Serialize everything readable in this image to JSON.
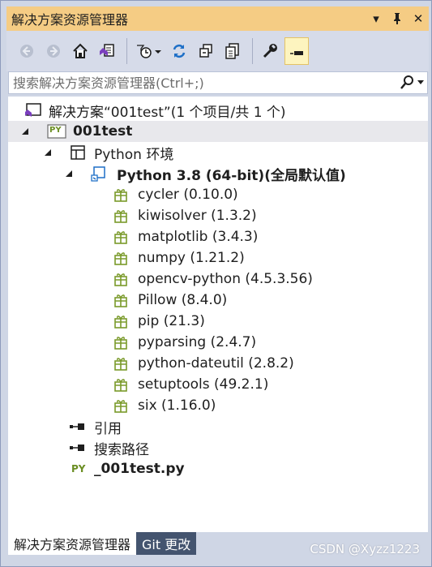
{
  "window": {
    "title": "解决方案资源管理器",
    "dropdown_glyph": "▾",
    "pin_glyph": "⊥",
    "close_glyph": "✕"
  },
  "toolbar": {
    "items": [
      "back-icon",
      "forward-icon",
      "home-icon",
      "vs-switch-view-icon",
      "pending-changes-filter-icon",
      "refresh-icon",
      "collapse-all-icon",
      "show-all-files-icon",
      "properties-icon",
      "preview-selected-icon"
    ]
  },
  "search": {
    "placeholder": "搜索解决方案资源管理器(Ctrl+;)"
  },
  "tree": {
    "solution": "解决方案“001test”(1 个项目/共 1 个)",
    "project": "001test",
    "env_group": "Python 环境",
    "interpreter": "Python 3.8 (64-bit)(全局默认值)",
    "packages": [
      "cycler (0.10.0)",
      "kiwisolver (1.3.2)",
      "matplotlib (3.4.3)",
      "numpy (1.21.2)",
      "opencv-python (4.5.3.56)",
      "Pillow (8.4.0)",
      "pip (21.3)",
      "pyparsing (2.4.7)",
      "python-dateutil (2.8.2)",
      "setuptools (49.2.1)",
      "six (1.16.0)"
    ],
    "references": "引用",
    "search_paths": "搜索路径",
    "file": "_001test.py",
    "py_badge": "PY"
  },
  "tabs": {
    "solution_explorer": "解决方案资源管理器",
    "git_changes": "Git 更改"
  },
  "watermark": "CSDN @Xyzz1223",
  "colors": {
    "title_bar": "#f5cc84",
    "toolbar": "#d6dbe9",
    "selected_row": "#e8e8ec",
    "package_icon": "#7a9a2a",
    "inactive_tab": "#44546f"
  }
}
